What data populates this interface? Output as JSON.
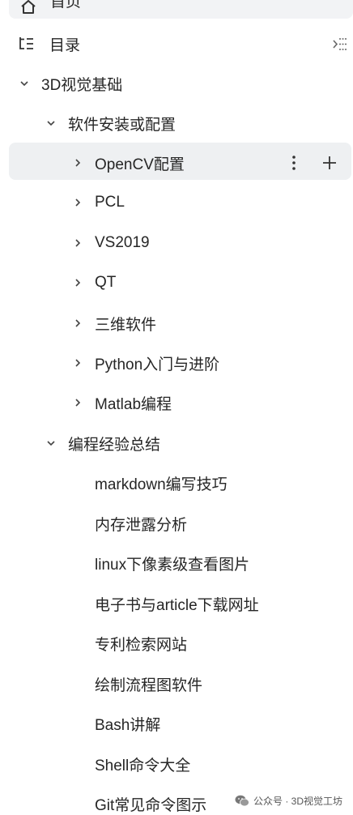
{
  "home": {
    "label": "首页"
  },
  "toc": {
    "label": "目录"
  },
  "tree": {
    "section1": {
      "label": "3D视觉基础",
      "child": {
        "label": "软件安装或配置",
        "items": [
          {
            "label": "OpenCV配置"
          },
          {
            "label": "PCL"
          },
          {
            "label": "VS2019"
          },
          {
            "label": "QT"
          },
          {
            "label": "三维软件"
          },
          {
            "label": "Python入门与进阶"
          },
          {
            "label": "Matlab编程"
          }
        ]
      }
    },
    "section2": {
      "label": "编程经验总结",
      "items": [
        {
          "label": "markdown编写技巧"
        },
        {
          "label": "内存泄露分析"
        },
        {
          "label": "linux下像素级查看图片"
        },
        {
          "label": "电子书与article下载网址"
        },
        {
          "label": "专利检索网站"
        },
        {
          "label": "绘制流程图软件"
        },
        {
          "label": "Bash讲解"
        },
        {
          "label": "Shell命令大全"
        },
        {
          "label": "Git常见命令图示"
        }
      ]
    }
  },
  "watermark": {
    "text": "公众号 · 3D视觉工坊"
  },
  "icons": {
    "home": "home-icon",
    "toc": "toc-icon",
    "toc_toggle": "toc-collapse-icon",
    "expanded": "chevron-down-icon",
    "collapsed": "chevron-right-icon",
    "more": "more-vertical-icon",
    "add": "plus-icon",
    "wechat": "wechat-icon"
  },
  "colors": {
    "active_bg": "#eef0f2",
    "text": "#262626"
  }
}
